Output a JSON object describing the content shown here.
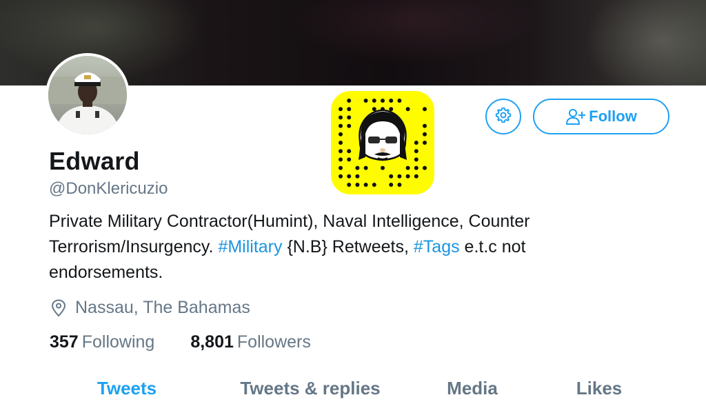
{
  "profile": {
    "name": "Edward",
    "handle": "@DonKlericuzio",
    "bio_parts": [
      "Private Military Contractor(Humint), Naval Intelligence, Counter Terrorism/Insurgency. ",
      "#Military",
      " {N.B} Retweets, ",
      "#Tags",
      " e.t.c not endorsements."
    ],
    "location": "Nassau, The Bahamas"
  },
  "stats": {
    "following_count": "357",
    "following_label": "Following",
    "followers_count": "8,801",
    "followers_label": "Followers"
  },
  "actions": {
    "follow_label": "Follow"
  },
  "tabs": [
    {
      "label": "Tweets",
      "active": true
    },
    {
      "label": "Tweets & replies",
      "active": false
    },
    {
      "label": "Media",
      "active": false
    },
    {
      "label": "Likes",
      "active": false
    }
  ],
  "icons": {
    "settings": "gear-icon",
    "follow": "add-person-icon",
    "location": "location-pin-icon"
  },
  "colors": {
    "accent": "#1da1f2",
    "hashtag": "#1b95e0",
    "muted": "#657786",
    "snapcode_yellow": "#fffc00"
  }
}
